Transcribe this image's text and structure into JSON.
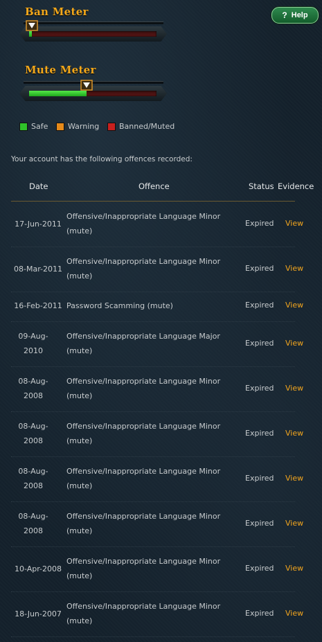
{
  "ban_meter": {
    "title": "Ban Meter",
    "level": 0.02
  },
  "mute_meter": {
    "title": "Mute Meter",
    "level": 0.45
  },
  "help_button": {
    "icon": "question-icon",
    "glyph": "?",
    "label": "Help"
  },
  "legend": [
    {
      "label": "Safe",
      "color": "#2fc22a"
    },
    {
      "label": "Warning",
      "color": "#e58a1a"
    },
    {
      "label": "Banned/Muted",
      "color": "#c8201e"
    }
  ],
  "intro_text": "Your account has the following offences recorded:",
  "table": {
    "headers": {
      "date": "Date",
      "offence": "Offence",
      "status": "Status",
      "evidence": "Evidence"
    },
    "rows": [
      {
        "date": "17-Jun-2011",
        "offence": "Offensive/Inappropriate Language Minor (mute)",
        "status": "Expired",
        "evidence": "View"
      },
      {
        "date": "08-Mar-2011",
        "offence": "Offensive/Inappropriate Language Minor (mute)",
        "status": "Expired",
        "evidence": "View"
      },
      {
        "date": "16-Feb-2011",
        "offence": "Password Scamming (mute)",
        "status": "Expired",
        "evidence": "View"
      },
      {
        "date": "09-Aug-2010",
        "offence": "Offensive/Inappropriate Language Major (mute)",
        "status": "Expired",
        "evidence": "View"
      },
      {
        "date": "08-Aug-2008",
        "offence": "Offensive/Inappropriate Language Minor (mute)",
        "status": "Expired",
        "evidence": "View"
      },
      {
        "date": "08-Aug-2008",
        "offence": "Offensive/Inappropriate Language Minor (mute)",
        "status": "Expired",
        "evidence": "View"
      },
      {
        "date": "08-Aug-2008",
        "offence": "Offensive/Inappropriate Language Minor (mute)",
        "status": "Expired",
        "evidence": "View"
      },
      {
        "date": "08-Aug-2008",
        "offence": "Offensive/Inappropriate Language Minor (mute)",
        "status": "Expired",
        "evidence": "View"
      },
      {
        "date": "10-Apr-2008",
        "offence": "Offensive/Inappropriate Language Minor (mute)",
        "status": "Expired",
        "evidence": "View"
      },
      {
        "date": "18-Jun-2007",
        "offence": "Offensive/Inappropriate Language Minor (mute)",
        "status": "Expired",
        "evidence": "View"
      }
    ]
  }
}
